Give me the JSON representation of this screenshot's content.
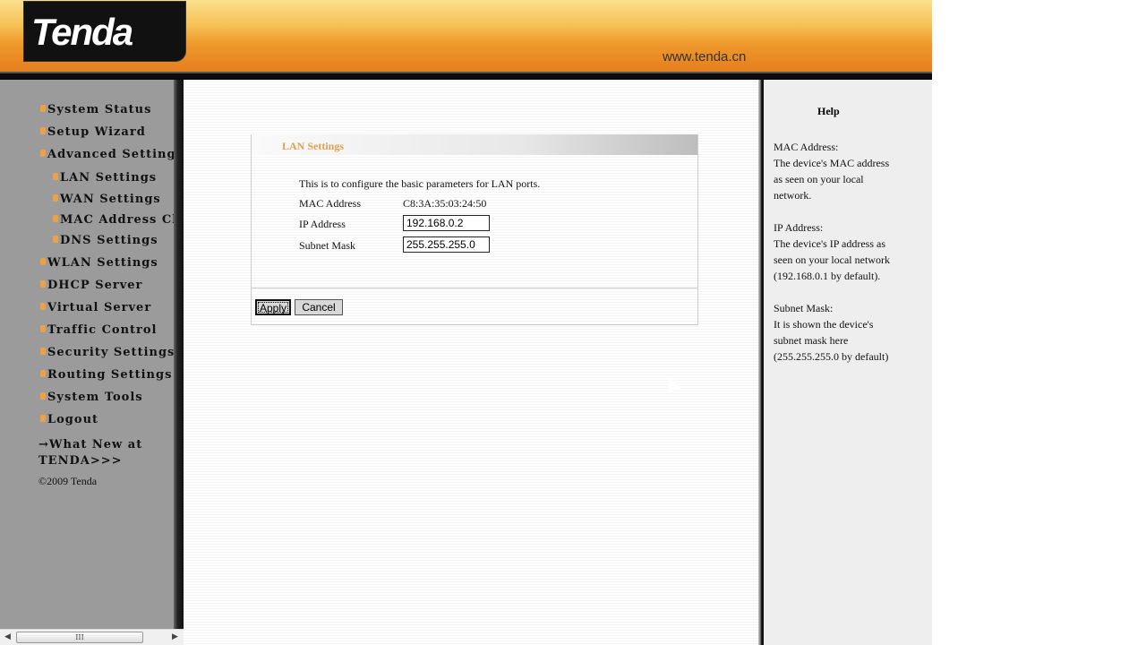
{
  "header": {
    "logo": "Tenda",
    "url": "www.tenda.cn"
  },
  "sidebar": {
    "items": [
      {
        "label": "System Status",
        "sub": false
      },
      {
        "label": "Setup Wizard",
        "sub": false
      },
      {
        "label": "Advanced Settings",
        "sub": false
      },
      {
        "label": "LAN Settings",
        "sub": true
      },
      {
        "label": "WAN Settings",
        "sub": true
      },
      {
        "label": "MAC Address Clone",
        "sub": true
      },
      {
        "label": "DNS Settings",
        "sub": true
      },
      {
        "label": "WLAN Settings",
        "sub": false
      },
      {
        "label": "DHCP Server",
        "sub": false
      },
      {
        "label": "Virtual Server",
        "sub": false
      },
      {
        "label": "Traffic Control",
        "sub": false
      },
      {
        "label": "Security Settings",
        "sub": false
      },
      {
        "label": "Routing Settings",
        "sub": false
      },
      {
        "label": "System Tools",
        "sub": false
      },
      {
        "label": "Logout",
        "sub": false
      }
    ],
    "whatnew_line1": "→What New at",
    "whatnew_line2": "TENDA>>>",
    "copyright": "©2009 Tenda"
  },
  "panel": {
    "title": "LAN Settings",
    "description": "This is to configure the basic parameters for LAN ports.",
    "mac_label": "MAC Address",
    "mac_value": "C8:3A:35:03:24:50",
    "ip_label": "IP Address",
    "ip_value": "192.168.0.2",
    "mask_label": "Subnet Mask",
    "mask_value": "255.255.255.0",
    "apply": "Apply",
    "cancel": "Cancel"
  },
  "help": {
    "title": "Help",
    "mac": "MAC Address:\nThe device's MAC address\nas seen on your local\nnetwork.",
    "ip": "IP Address:\nThe device's IP address as\nseen on your local network\n(192.168.0.1 by default).",
    "mask": "Subnet Mask:\nIt is shown the device's\nsubnet mask here\n(255.255.255.0 by default)"
  },
  "scrollbar": {
    "grip": "III"
  },
  "colors": {
    "accent": "#e57e1d",
    "title": "#e0a050"
  }
}
